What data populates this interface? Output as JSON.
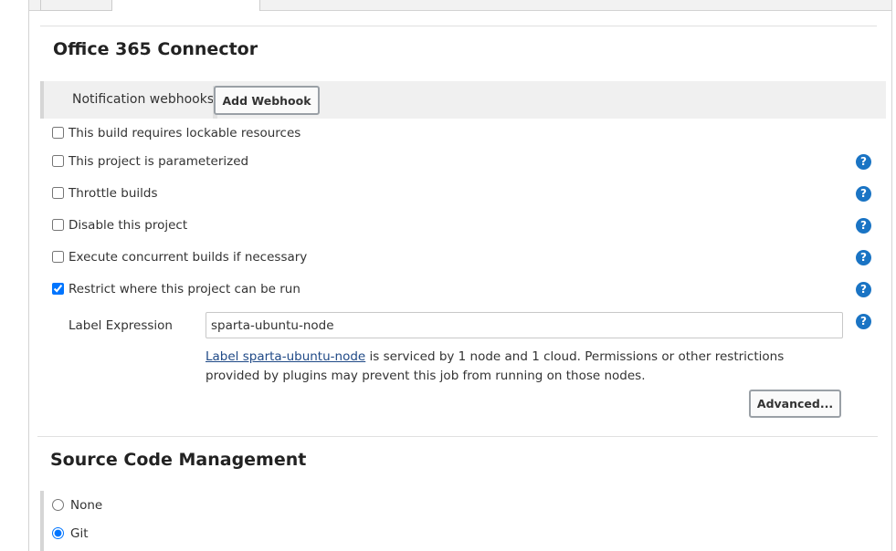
{
  "office365": {
    "title": "Office 365 Connector",
    "webhook_label": "Notification webhooks",
    "add_webhook": "Add Webhook"
  },
  "options": [
    {
      "label": "This build requires lockable resources",
      "checked": false,
      "help": false
    },
    {
      "label": "This project is parameterized",
      "checked": false,
      "help": true
    },
    {
      "label": "Throttle builds",
      "checked": false,
      "help": true
    },
    {
      "label": "Disable this project",
      "checked": false,
      "help": true
    },
    {
      "label": "Execute concurrent builds if necessary",
      "checked": false,
      "help": true
    },
    {
      "label": "Restrict where this project can be run",
      "checked": true,
      "help": true
    }
  ],
  "label_expression": {
    "label": "Label Expression",
    "value": "sparta-ubuntu-node",
    "info_link": "Label sparta-ubuntu-node",
    "info_text": " is serviced by 1 node and 1 cloud. Permissions or other restrictions provided by plugins may prevent this job from running on those nodes.",
    "advanced": "Advanced..."
  },
  "scm": {
    "title": "Source Code Management",
    "options": [
      {
        "label": "None",
        "selected": false
      },
      {
        "label": "Git",
        "selected": true
      }
    ]
  },
  "help_glyph": "?",
  "icons": {
    "help": "question-circle-icon"
  },
  "colors": {
    "help": "#1a74c4",
    "link": "#204a87",
    "checkbox": "#1a74c4"
  }
}
